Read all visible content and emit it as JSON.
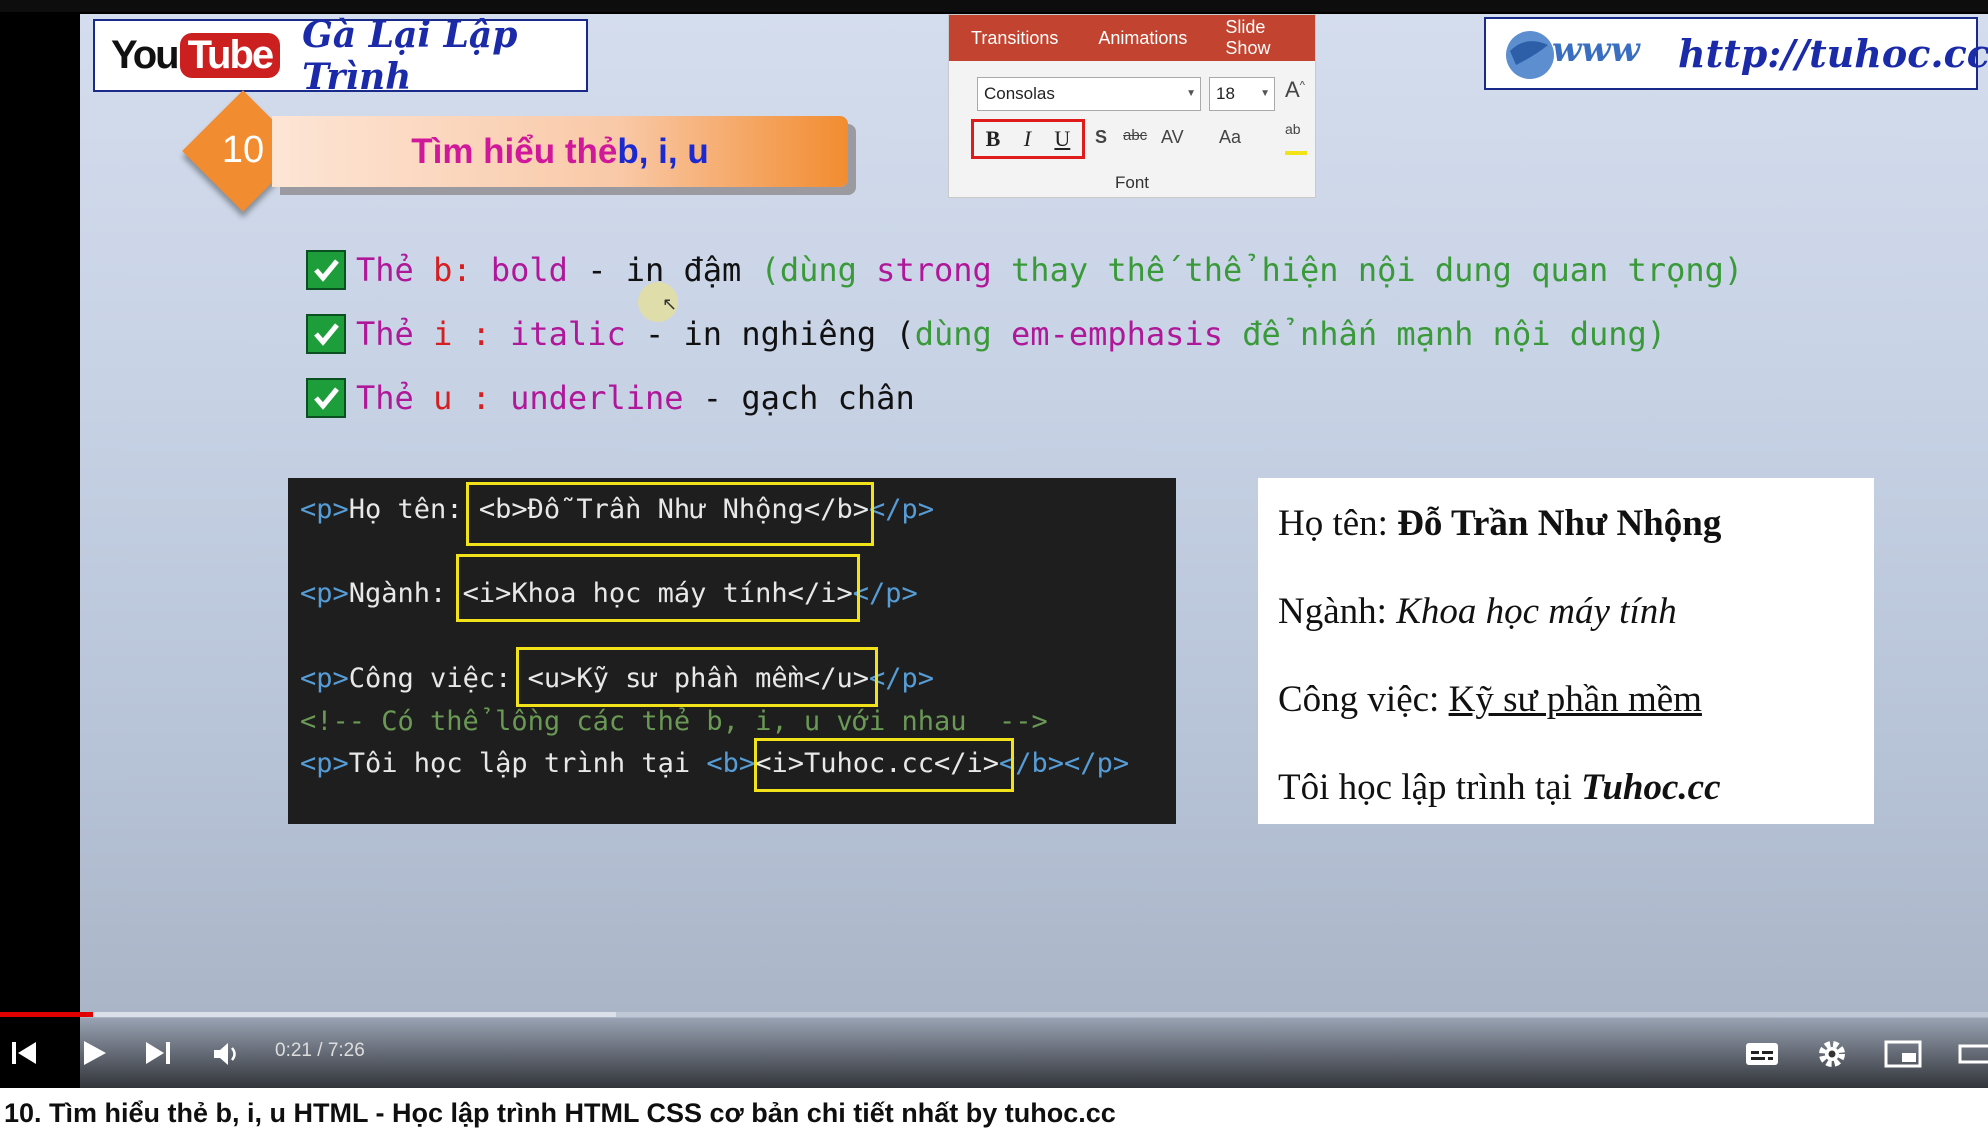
{
  "slide": {
    "logo_you": "You",
    "logo_tube": "Tube",
    "channel_name": "Gà Lại Lập Trình",
    "lesson_number": "10",
    "lesson_title_part1": "Tìm hiểu thẻ ",
    "lesson_title_part2": "b, i, u",
    "website_url": "http://tuhoc.cc",
    "website_prefix": "www"
  },
  "ribbon": {
    "tabs": [
      "Transitions",
      "Animations",
      "Slide Show"
    ],
    "font_name": "Consolas",
    "font_size": "18",
    "bold": "B",
    "italic": "I",
    "underline": "U",
    "strike": "S",
    "abc": "abc",
    "spacing": "AV",
    "case": "Aa",
    "grow": "A",
    "group_label": "Font"
  },
  "bullets": [
    {
      "tag": "Thẻ ",
      "name": "b",
      "sep": ": ",
      "en": "bold",
      "dash": " - ",
      "vi": "in đậm ",
      "paren_open": "(dùng ",
      "kw": "strong",
      "rest": " thay thế thể hiện nội dung quan trọng)"
    },
    {
      "tag": "Thẻ ",
      "name": "i",
      "sep": " : ",
      "en": "italic",
      "dash": " - ",
      "vi": "in nghiêng (",
      "paren_open": "dùng ",
      "kw": "em-emphasis",
      "rest": " để nhấn mạnh nội dung)"
    },
    {
      "tag": "Thẻ ",
      "name": "u",
      "sep": " : ",
      "en": "underline",
      "dash": " - ",
      "vi": "gạch chân",
      "paren_open": "",
      "kw": "",
      "rest": ""
    }
  ],
  "code": {
    "line1_open": "<p>",
    "line1_label": "Họ tên: ",
    "line1_inner": "<b>Đỗ Trần Như Nhộng</b>",
    "line1_close": "</p>",
    "line2_open": "<p>",
    "line2_label": "Ngành: ",
    "line2_inner": "<i>Khoa học máy tính</i>",
    "line2_close": "</p>",
    "line3_open": "<p>",
    "line3_label": "Công việc: ",
    "line3_inner": "<u>Kỹ sư phần mềm</u>",
    "line3_close": "</p>",
    "comment": "<!-- Có thể lồng các thẻ b, i, u với nhau  -->",
    "line5_open": "<p>",
    "line5_label": "Tôi học lập trình tại ",
    "line5_b": "<b>",
    "line5_inner": "<i>Tuhoc.cc</i>",
    "line5_close": "</b></p>"
  },
  "preview": {
    "name_label": "Họ tên: ",
    "name_value": "Đỗ Trần Như Nhộng",
    "major_label": "Ngành: ",
    "major_value": "Khoa học máy tính",
    "job_label": "Công việc: ",
    "job_value": "Kỹ sư phần mềm",
    "site_label": "Tôi học lập trình tại ",
    "site_value": "Tuhoc.cc"
  },
  "player": {
    "time": "0:21 / 7:26",
    "progress_fraction": 0.047,
    "buffered_fraction": 0.31,
    "accent_color": "#e00000"
  },
  "video_title": "10. Tìm hiểu thẻ b, i, u HTML - Học lập trình HTML CSS cơ bản chi tiết nhất by tuhoc.cc"
}
